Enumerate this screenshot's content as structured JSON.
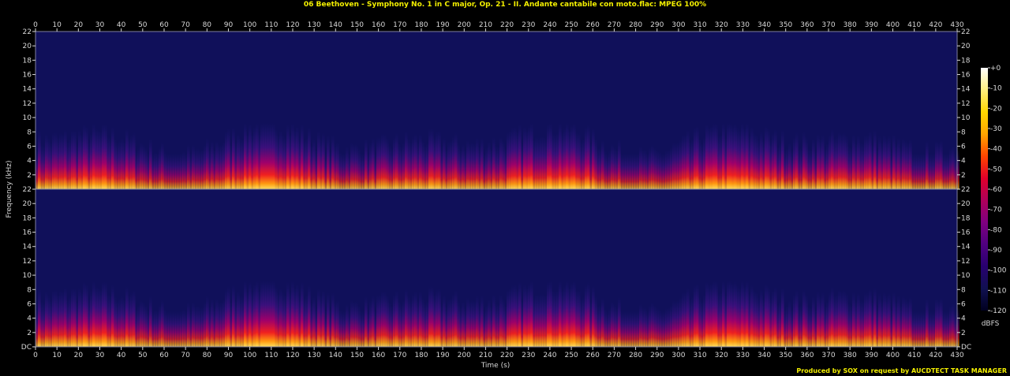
{
  "title": "06 Beethoven - Symphony No. 1 in C major, Op. 21 - II. Andante cantabile con moto.flac: MPEG 100%",
  "credit": "Produced by SOX on request by AUCDTECT TASK MANAGER",
  "chart_data": {
    "type": "heatmap",
    "xlabel": "Time (s)",
    "ylabel": "Frequency (kHz)",
    "xlim": [
      0,
      430
    ],
    "ylim": [
      0,
      22
    ],
    "x_ticks": [
      0,
      10,
      20,
      30,
      40,
      50,
      60,
      70,
      80,
      90,
      100,
      110,
      120,
      130,
      140,
      150,
      160,
      170,
      180,
      190,
      200,
      210,
      220,
      230,
      240,
      250,
      260,
      270,
      280,
      290,
      300,
      310,
      320,
      330,
      340,
      350,
      360,
      370,
      380,
      390,
      400,
      410,
      420,
      430
    ],
    "y_ticks": [
      2,
      4,
      6,
      8,
      10,
      12,
      14,
      16,
      18,
      20,
      22
    ],
    "y_zero_label": "DC",
    "channels": 2,
    "colorbar": {
      "label": "dBFS",
      "ticks": [
        "+0",
        "-10",
        "-20",
        "-30",
        "-40",
        "-50",
        "-60",
        "-70",
        "-80",
        "-90",
        "-100",
        "-110",
        "-120"
      ],
      "colors": [
        "#ffffff",
        "#fff080",
        "#ffd700",
        "#ffa500",
        "#ff4500",
        "#e0002a",
        "#b0005a",
        "#800080",
        "#500080",
        "#280070",
        "#101050",
        "#000020"
      ]
    },
    "colors": {
      "background": "#10105a",
      "text": "#d8d8d8",
      "title": "#f4f000",
      "frame": "#8080a0"
    }
  }
}
